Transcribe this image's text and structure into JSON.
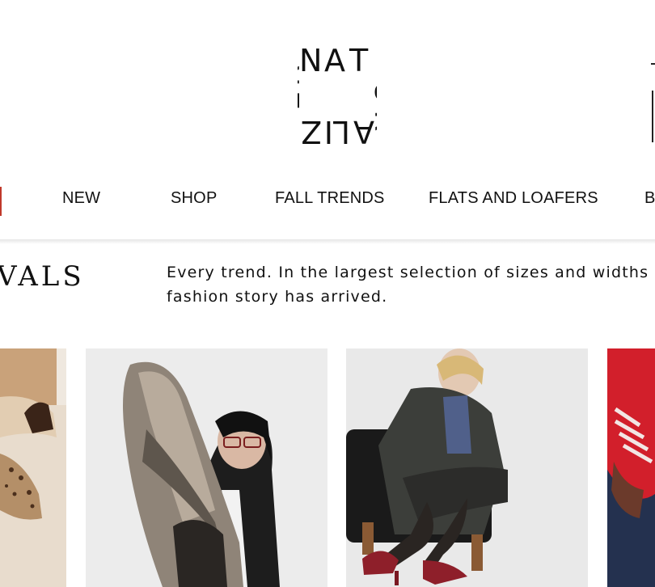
{
  "brand": {
    "logo_text": "NATURALIZER"
  },
  "nav": {
    "items": [
      {
        "label": "NEW"
      },
      {
        "label": "SHOP"
      },
      {
        "label": "FALL TRENDS"
      },
      {
        "label": "FLATS AND LOAFERS"
      },
      {
        "label": "B"
      }
    ]
  },
  "section": {
    "title": "VALS",
    "description_line1": "Every trend. In the largest selection of sizes and widths",
    "description_line2": "fashion story has arrived."
  },
  "product_cards": [
    {
      "image": "leopard-boot-photo"
    },
    {
      "image": "metallic-loafer-photo"
    },
    {
      "image": "red-heel-model-photo"
    },
    {
      "image": "red-sneaker-photo"
    }
  ]
}
